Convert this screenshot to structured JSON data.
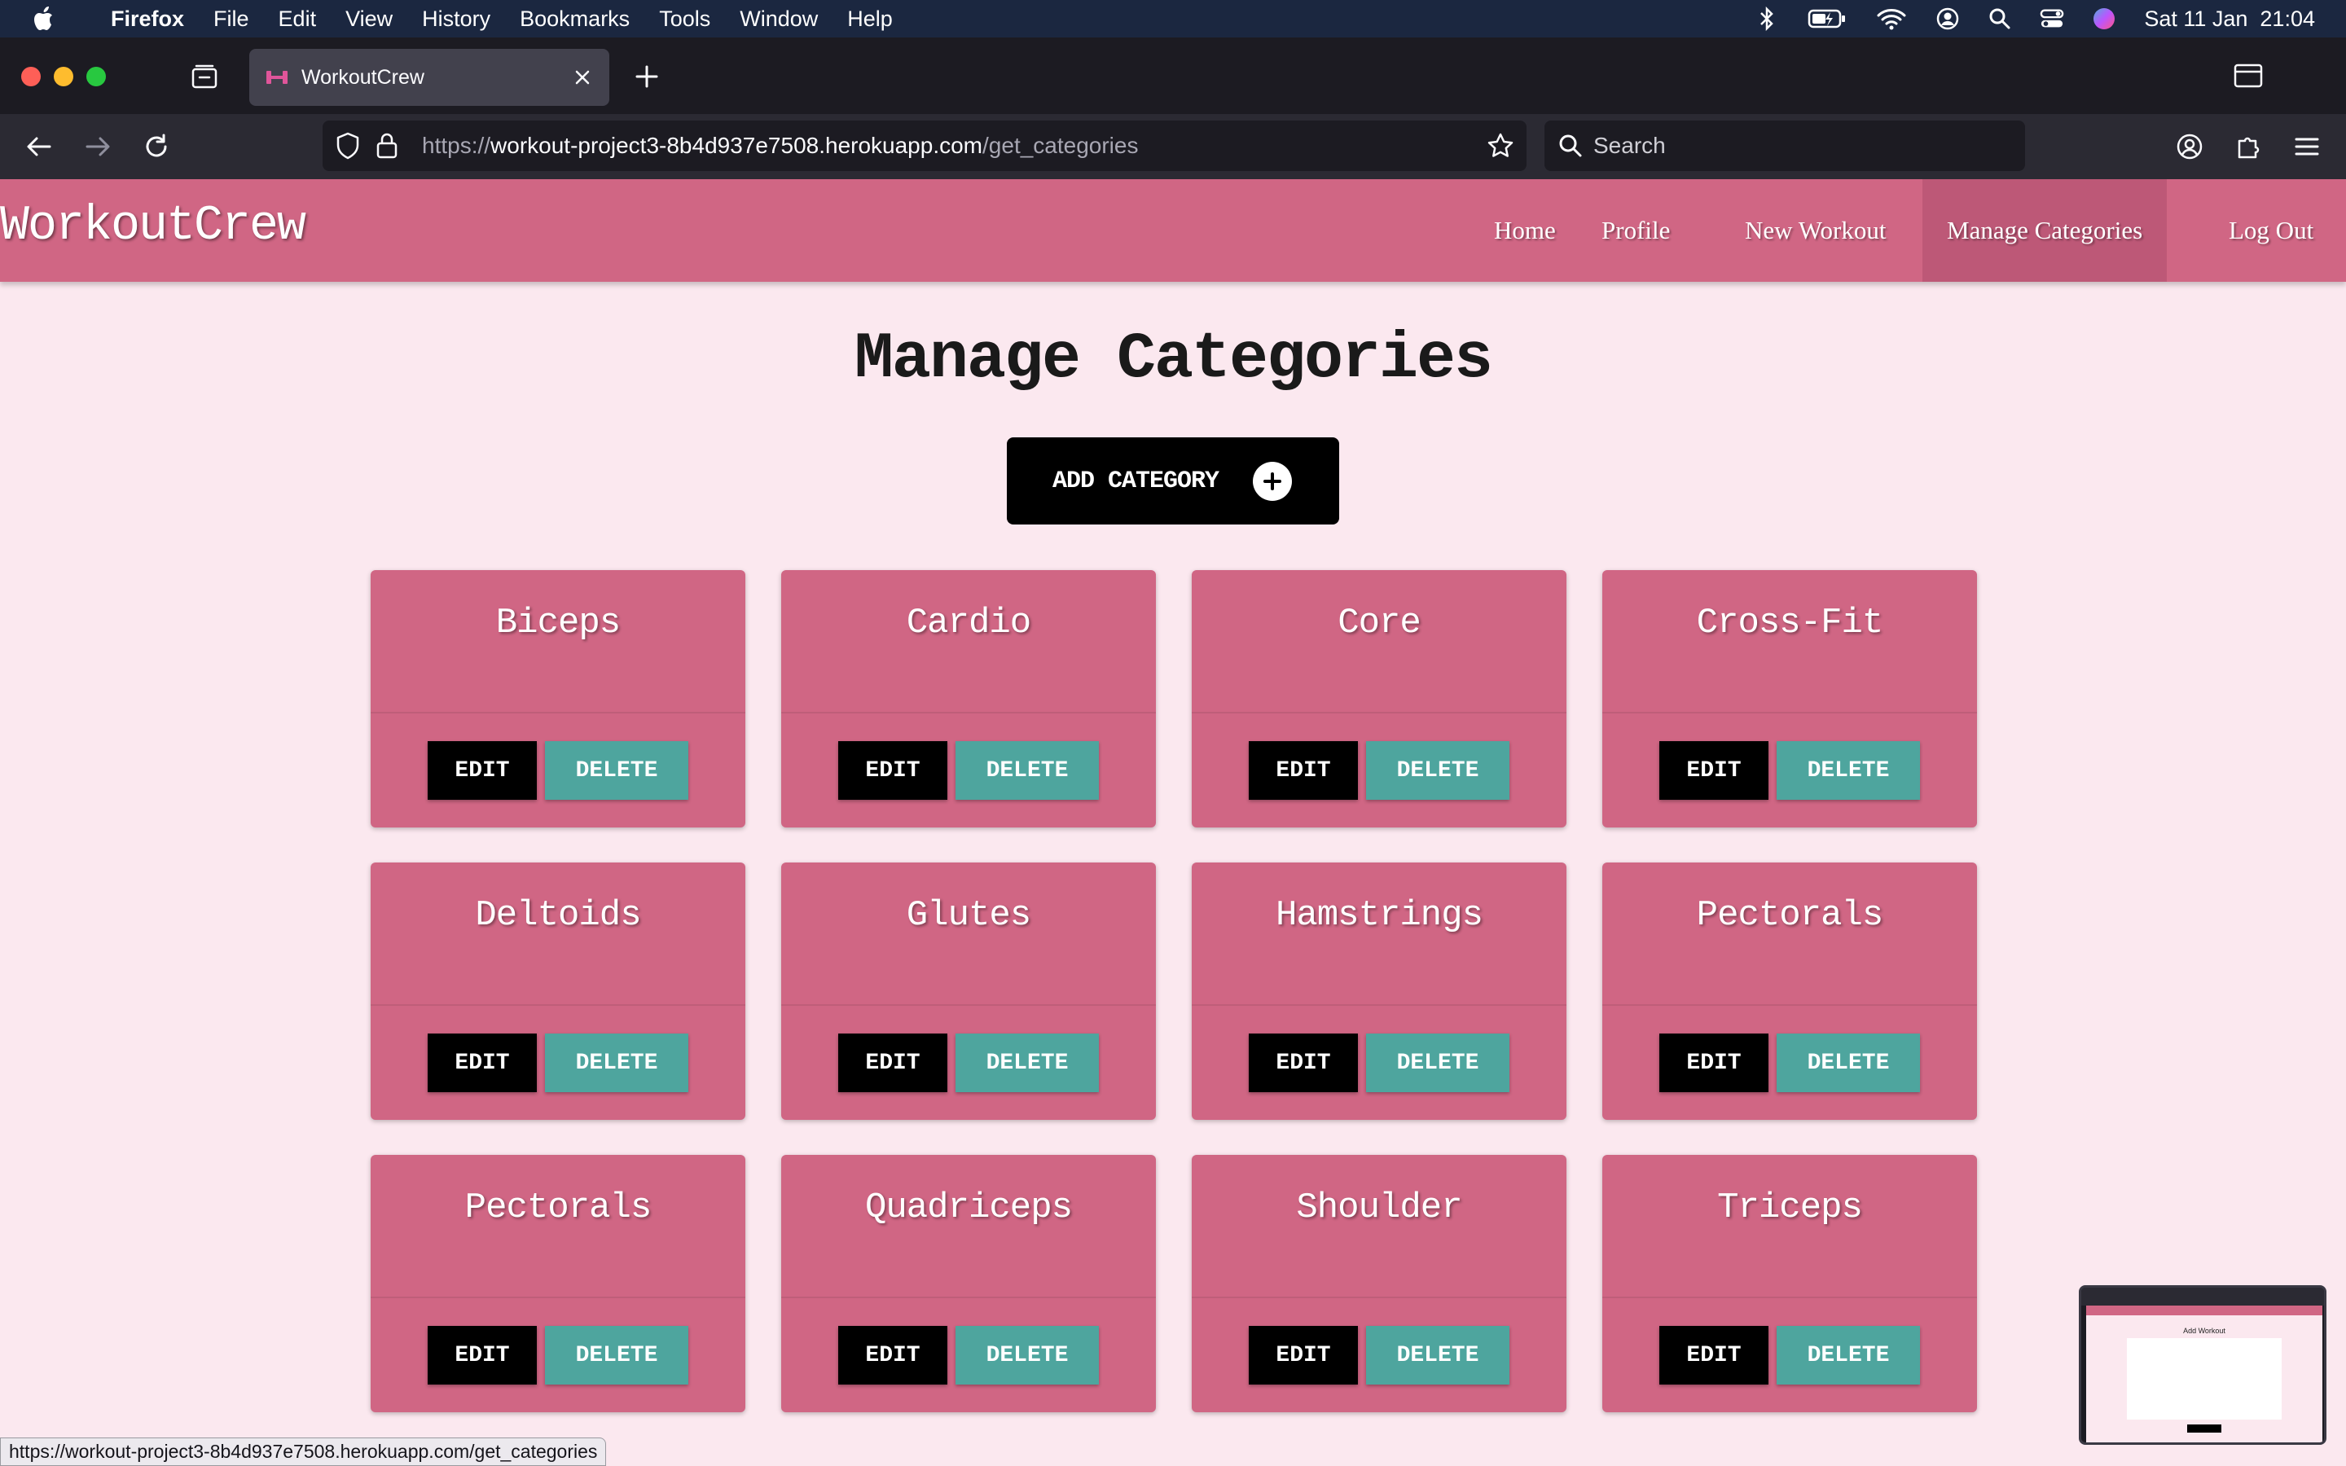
{
  "menubar": {
    "app": "Firefox",
    "items": [
      "File",
      "Edit",
      "View",
      "History",
      "Bookmarks",
      "Tools",
      "Window",
      "Help"
    ],
    "clock": "Sat 11 Jan  21:04"
  },
  "browser": {
    "tab_title": "WorkoutCrew",
    "url_scheme": "https://",
    "url_host": "workout-project3-8b4d937e7508.herokuapp.com",
    "url_path": "/get_categories",
    "search_placeholder": "Search",
    "status_url": "https://workout-project3-8b4d937e7508.herokuapp.com/get_categories"
  },
  "site": {
    "brand": "WorkoutCrew",
    "nav": [
      "Home",
      "Profile",
      "New Workout",
      "Manage Categories",
      "Log Out"
    ],
    "active_nav": "Manage Categories"
  },
  "main": {
    "title": "Manage Categories",
    "add_button": "ADD CATEGORY",
    "edit_label": "EDIT",
    "delete_label": "DELETE",
    "categories": [
      "Biceps",
      "Cardio",
      "Core",
      "Cross-Fit",
      "Deltoids",
      "Glutes",
      "Hamstrings",
      "Pectorals",
      "Pectorals",
      "Quadriceps",
      "Shoulder",
      "Triceps"
    ]
  },
  "thumbnail": {
    "title": "Add Workout"
  },
  "colors": {
    "navbar": "#d06684",
    "card": "#d06684",
    "delete_button": "#4ea59e",
    "page_background": "#fbe8ef"
  }
}
